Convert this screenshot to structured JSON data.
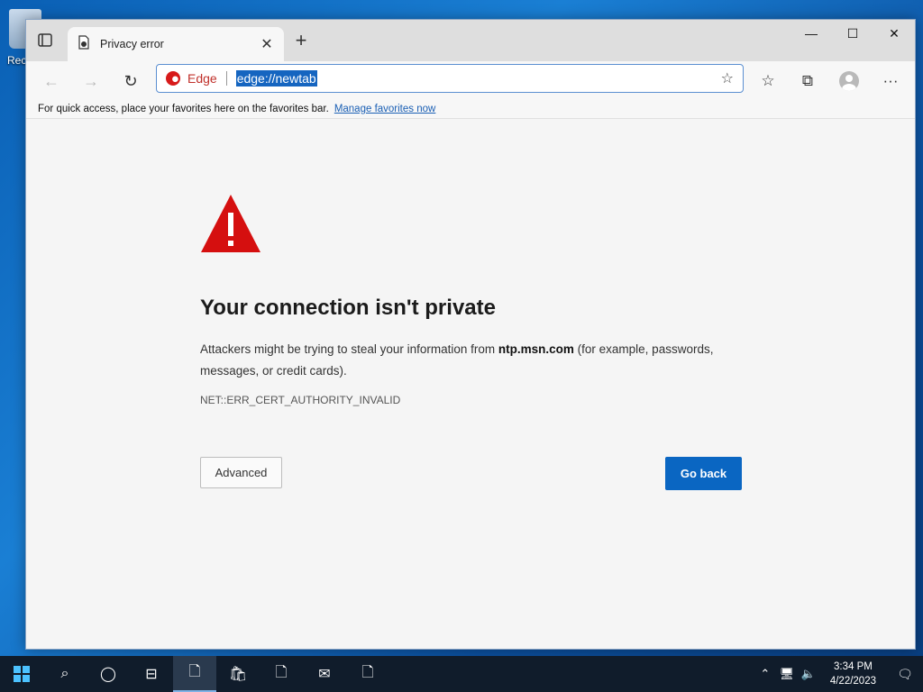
{
  "desktop": {
    "icon_label": "Rec"
  },
  "browser": {
    "tab_title": "Privacy error",
    "address_prefix": "Edge",
    "url": "edge://newtab",
    "favorites_hint": "For quick access, place your favorites here on the favorites bar.",
    "manage_favorites": "Manage favorites now"
  },
  "error_page": {
    "heading": "Your connection isn't private",
    "desc_before": "Attackers might be trying to steal your information from ",
    "host": "ntp.msn.com",
    "desc_after": " (for example, passwords, messages, or credit cards).",
    "code": "NET::ERR_CERT_AUTHORITY_INVALID",
    "advanced_label": "Advanced",
    "back_label": "Go back"
  },
  "taskbar": {
    "time": "3:34 PM",
    "date": "4/22/2023"
  },
  "colors": {
    "accent": "#0a66c2",
    "warning": "#d50f0f",
    "url_highlight": "#1565c0"
  }
}
